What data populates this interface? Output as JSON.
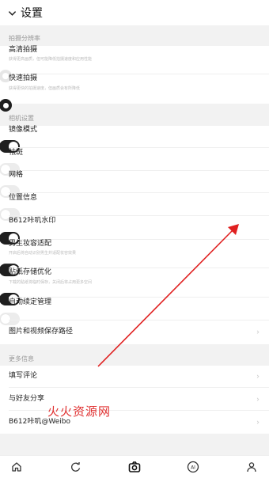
{
  "header": {
    "title": "设置"
  },
  "sections": {
    "resolution": "拍摄分辨率",
    "camera": "相机设置",
    "more": "更多信息"
  },
  "resolution_rows": [
    {
      "label": "高清拍摄",
      "sub": "获得更高画质，但可能降低拍摄速度和应用性能",
      "selected": false
    },
    {
      "label": "快速拍摄",
      "sub": "获得更快的拍摄速度，但画质会有所降低",
      "selected": true
    }
  ],
  "camera_rows": [
    {
      "label": "镜像模式",
      "sub": "",
      "on": true
    },
    {
      "label": "祛斑",
      "sub": "",
      "on": false
    },
    {
      "label": "网格",
      "sub": "",
      "on": false
    },
    {
      "label": "位置信息",
      "sub": "",
      "on": false
    },
    {
      "label": "B612咔叽水印",
      "sub": "",
      "on": true
    },
    {
      "label": "男生妆容适配",
      "sub": "开启后将自动识别男生并适配妆容效果",
      "on": true
    },
    {
      "label": "贴纸存储优化",
      "sub": "下载的贴纸将临时保存，关闭后将占用更多空间",
      "on": true
    },
    {
      "label": "自动续定管理",
      "sub": "",
      "on": false
    },
    {
      "label": "图片和视频保存路径",
      "sub": "",
      "chevron": true
    }
  ],
  "more_rows": [
    {
      "label": "填写评论"
    },
    {
      "label": "与好友分享"
    },
    {
      "label": "B612咔叽@Weibo"
    }
  ],
  "watermark": "火火资源网",
  "tabbar": [
    "home-icon",
    "refresh-icon",
    "camera-icon",
    "ai-icon",
    "profile-icon"
  ],
  "colors": {
    "accent": "#1f1f1f",
    "arrow": "#e02020",
    "watermark": "#e03030"
  }
}
